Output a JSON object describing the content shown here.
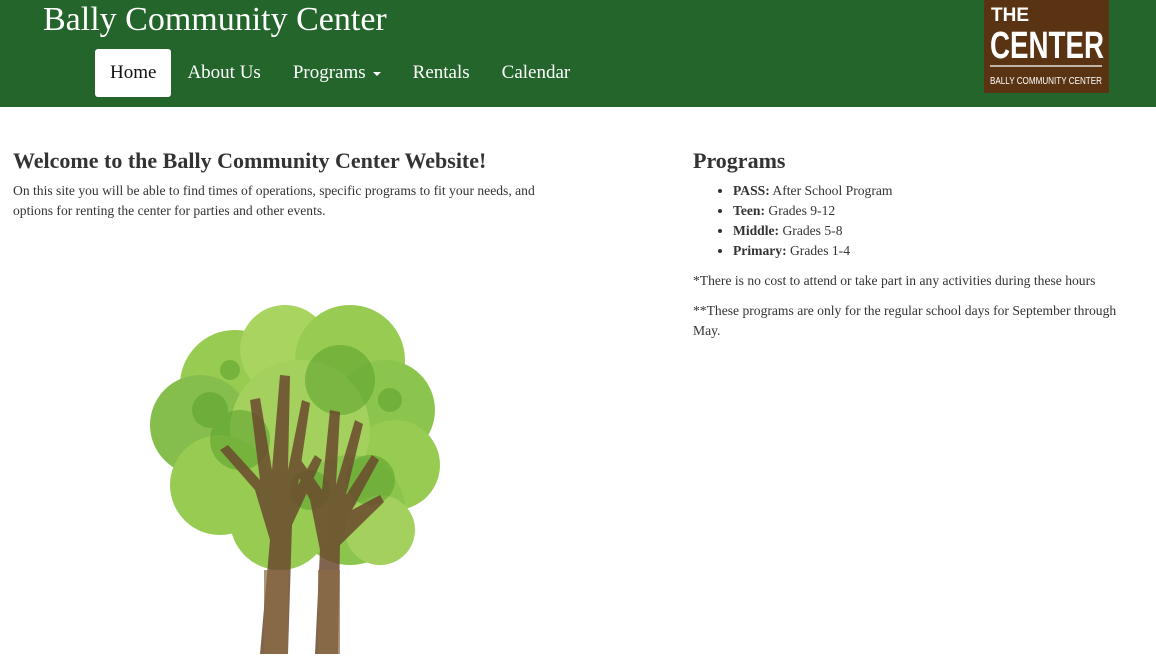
{
  "header": {
    "site_title": "Bally Community Center",
    "nav": [
      {
        "label": "Home",
        "active": true
      },
      {
        "label": "About Us",
        "active": false
      },
      {
        "label": "Programs",
        "active": false,
        "has_dropdown": true
      },
      {
        "label": "Rentals",
        "active": false
      },
      {
        "label": "Calendar",
        "active": false
      }
    ],
    "logo": {
      "line1": "THE",
      "line2": "CENTER",
      "line3": "BALLY COMMUNITY CENTER"
    }
  },
  "welcome": {
    "heading": "Welcome to the Bally Community Center Website!",
    "body": "On this site you will be able to find times of operations, specific programs to fit your needs, and options for renting the center for parties and other events."
  },
  "programs": {
    "heading": "Programs",
    "items": [
      {
        "name": "PASS:",
        "desc": " After School Program"
      },
      {
        "name": "Teen:",
        "desc": " Grades 9-12"
      },
      {
        "name": "Middle:",
        "desc": " Grades 5-8"
      },
      {
        "name": "Primary:",
        "desc": " Grades 1-4"
      }
    ],
    "note1": "*There is no cost to attend or take part in any activities during these hours",
    "note2": "**These programs are only for the regular school days for September through May."
  },
  "colors": {
    "header_bg": "#23652a",
    "logo_bg": "#5a3412",
    "tree_light": "#8cc63f",
    "tree_dark": "#5aa02c",
    "trunk": "#7a5a3a"
  },
  "icons": {
    "tree": "tree-hands-illustration",
    "caret": "caret-down-icon"
  }
}
